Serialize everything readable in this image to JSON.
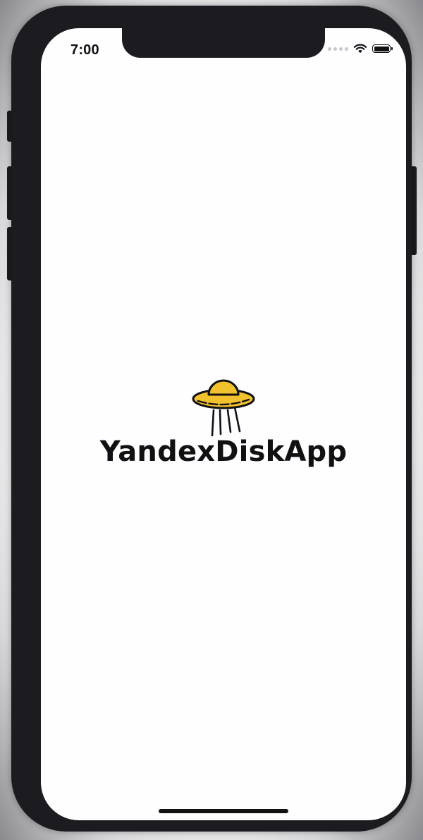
{
  "status_bar": {
    "time": "7:00",
    "signal_icon": "cellular-signal-icon",
    "wifi_icon": "wifi-icon",
    "battery_icon": "battery-icon"
  },
  "splash": {
    "logo_icon": "ufo-icon",
    "app_name": "YandexDiskApp"
  },
  "colors": {
    "background": "#fefdff",
    "text": "#111111",
    "accent": "#f2c22e",
    "device_frame": "#1c1b20"
  }
}
